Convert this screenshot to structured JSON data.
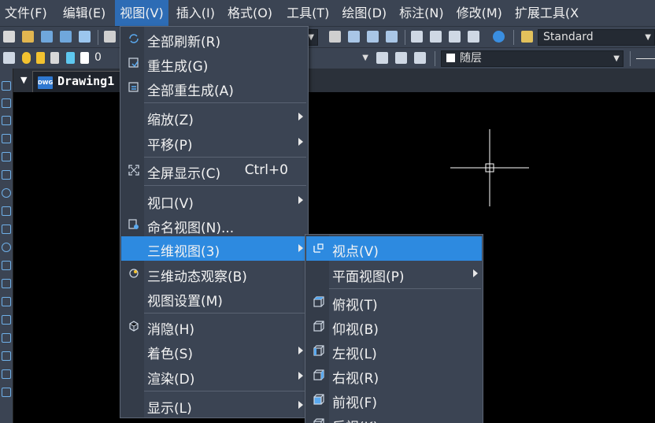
{
  "menubar": {
    "items": [
      "文件(F)",
      "编辑(E)",
      "视图(V)",
      "插入(I)",
      "格式(O)",
      "工具(T)",
      "绘图(D)",
      "标注(N)",
      "修改(M)",
      "扩展工具(X"
    ]
  },
  "toolbar": {
    "text_style": "Standard",
    "layer_value": "0",
    "linetype": "随层"
  },
  "tab": {
    "icon_text": "DWG",
    "title": "Drawing1"
  },
  "view_menu": {
    "items": [
      {
        "label": "全部刷新(R)"
      },
      {
        "label": "重生成(G)"
      },
      {
        "label": "全部重生成(A)"
      },
      {
        "label": "缩放(Z)"
      },
      {
        "label": "平移(P)"
      },
      {
        "label": "全屏显示(C)",
        "shortcut": "Ctrl+0"
      },
      {
        "label": "视口(V)"
      },
      {
        "label": "命名视图(N)..."
      },
      {
        "label": "三维视图(3)"
      },
      {
        "label": "三维动态观察(B)"
      },
      {
        "label": "视图设置(M)"
      },
      {
        "label": "消隐(H)"
      },
      {
        "label": "着色(S)"
      },
      {
        "label": "渲染(D)"
      },
      {
        "label": "显示(L)"
      }
    ]
  },
  "sub_menu": {
    "items": [
      {
        "label": "视点(V)"
      },
      {
        "label": "平面视图(P)"
      },
      {
        "label": "俯视(T)"
      },
      {
        "label": "仰视(B)"
      },
      {
        "label": "左视(L)"
      },
      {
        "label": "右视(R)"
      },
      {
        "label": "前视(F)"
      },
      {
        "label": "后视(K)"
      }
    ]
  },
  "colors": {
    "menu_bg": "#3b4453",
    "highlight": "#2d8ae0",
    "active_menubar": "#2d6cb5",
    "canvas": "#000000"
  }
}
